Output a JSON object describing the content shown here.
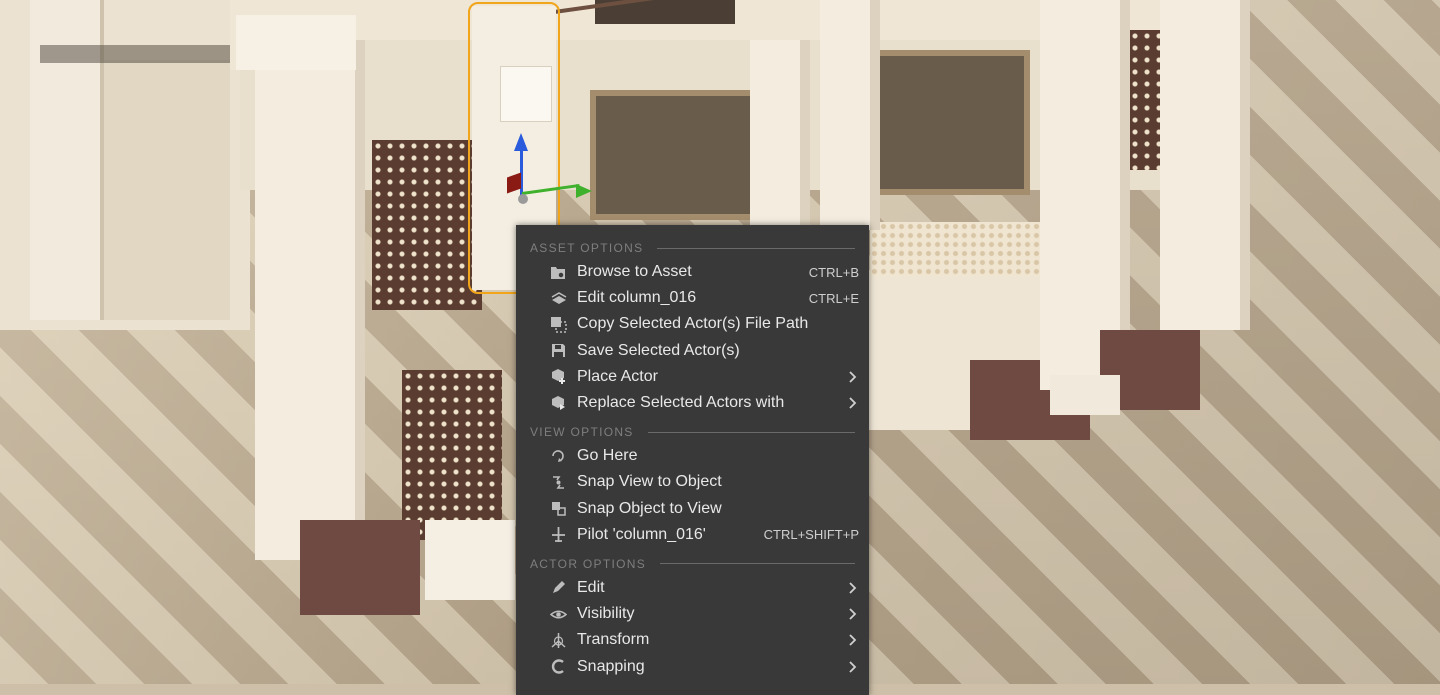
{
  "menu": {
    "sections": [
      {
        "title": "ASSET OPTIONS",
        "items": [
          {
            "label": "Browse to Asset",
            "shortcut": "CTRL+B",
            "icon": "browse-folder-icon"
          },
          {
            "label": "Edit column_016",
            "shortcut": "CTRL+E",
            "icon": "edit-mesh-icon"
          },
          {
            "label": "Copy Selected Actor(s) File Path",
            "shortcut": "",
            "icon": "copy-path-icon"
          },
          {
            "label": "Save Selected Actor(s)",
            "shortcut": "",
            "icon": "save-icon"
          },
          {
            "label": "Place Actor",
            "shortcut": "",
            "icon": "place-actor-icon",
            "submenu": true
          },
          {
            "label": "Replace Selected Actors with",
            "shortcut": "",
            "icon": "replace-actor-icon",
            "submenu": true
          }
        ]
      },
      {
        "title": "VIEW OPTIONS",
        "items": [
          {
            "label": "Go Here",
            "shortcut": "",
            "icon": "go-here-icon"
          },
          {
            "label": "Snap View to Object",
            "shortcut": "",
            "icon": "snap-view-icon"
          },
          {
            "label": "Snap Object to View",
            "shortcut": "",
            "icon": "snap-object-icon"
          },
          {
            "label": "Pilot 'column_016'",
            "shortcut": "CTRL+SHIFT+P",
            "icon": "pilot-icon"
          }
        ]
      },
      {
        "title": "ACTOR OPTIONS",
        "items": [
          {
            "label": "Edit",
            "shortcut": "",
            "icon": "pencil-icon",
            "submenu": true
          },
          {
            "label": "Visibility",
            "shortcut": "",
            "icon": "eye-icon",
            "submenu": true
          },
          {
            "label": "Transform",
            "shortcut": "",
            "icon": "transform-icon",
            "submenu": true
          },
          {
            "label": "Snapping",
            "shortcut": "",
            "icon": "snapping-icon",
            "submenu": true
          }
        ]
      }
    ]
  },
  "colors": {
    "menu_bg": "#393939",
    "selection_outline": "#f0a51a",
    "gizmo_x": "#8a1a14",
    "gizmo_y": "#3fb12c",
    "gizmo_z": "#2a5bdc"
  }
}
